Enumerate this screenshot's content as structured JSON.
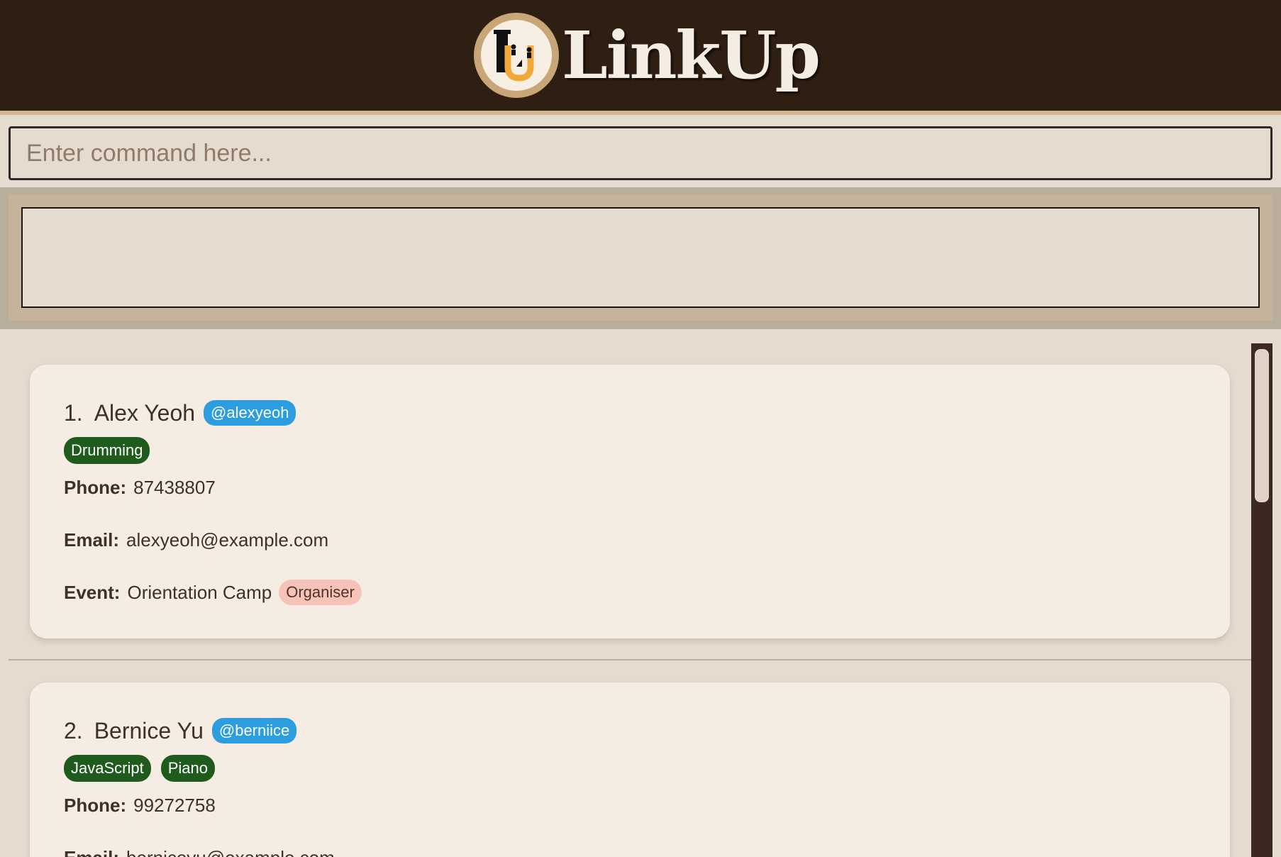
{
  "app": {
    "title": "LinkUp"
  },
  "command": {
    "placeholder": "Enter command here...",
    "value": ""
  },
  "result": {
    "text": ""
  },
  "persons": [
    {
      "index": "1.",
      "name": "Alex Yeoh",
      "handle": "@alexyeoh",
      "tags": [
        "Drumming"
      ],
      "phone_label": "Phone:",
      "phone": "87438807",
      "email_label": "Email:",
      "email": "alexyeoh@example.com",
      "event_label": "Event:",
      "event": "Orientation Camp",
      "role": "Organiser"
    },
    {
      "index": "2.",
      "name": "Bernice Yu",
      "handle": "@berniice",
      "tags": [
        "JavaScript",
        "Piano"
      ],
      "phone_label": "Phone:",
      "phone": "99272758",
      "email_label": "Email:",
      "email": "berniceyu@example.com"
    }
  ],
  "colors": {
    "header_bg": "#2f1f12",
    "handle_badge": "#2c9ee0",
    "tag_badge": "#1f5b1c",
    "role_badge": "#f7c2b7",
    "card_bg": "#f5ece3"
  },
  "icons": {
    "logo": "linkup-logo-icon"
  }
}
